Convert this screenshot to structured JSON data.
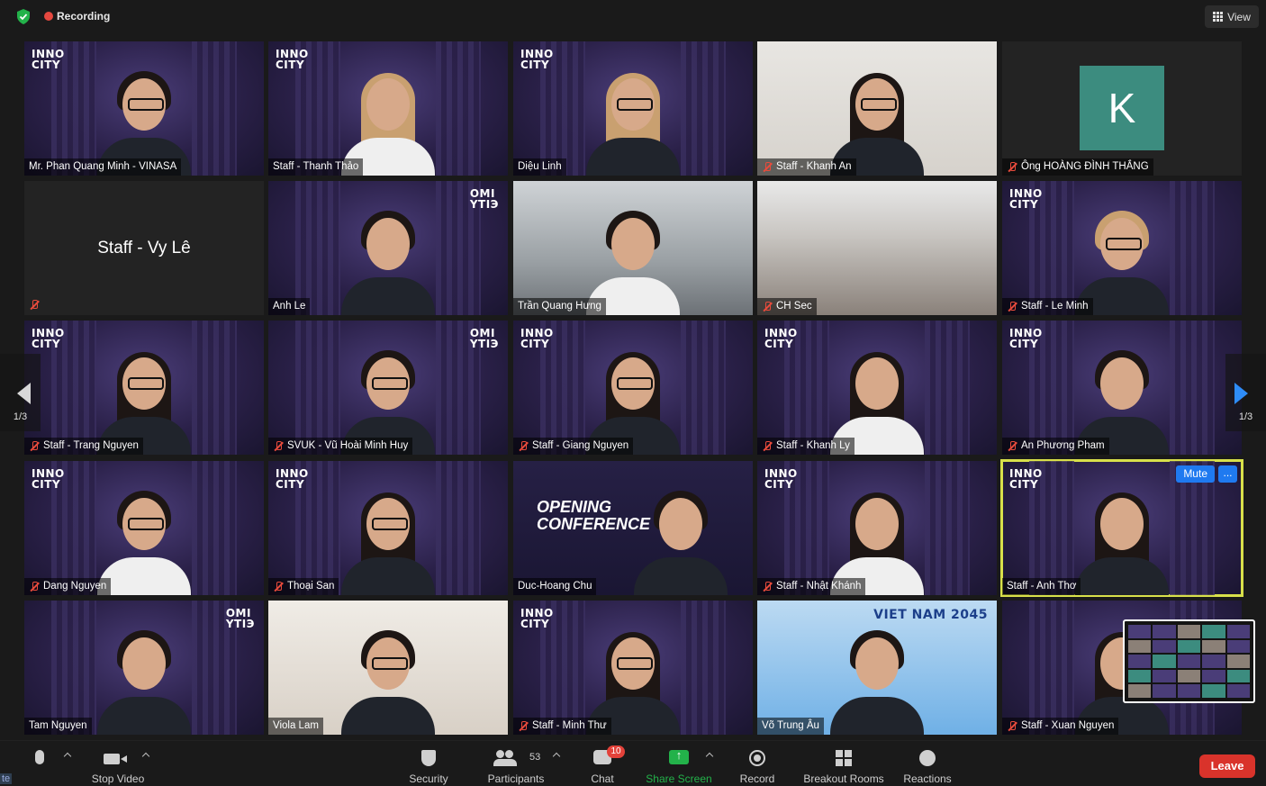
{
  "topbar": {
    "recording_label": "Recording",
    "view_label": "View"
  },
  "tiles": [
    {
      "name": "Mr. Phan Quang Minh - VINASA",
      "muted": false
    },
    {
      "name": "Staff - Thanh Thảo",
      "muted": false
    },
    {
      "name": "Diệu Linh",
      "muted": false
    },
    {
      "name": "Staff - Khanh An",
      "muted": true
    },
    {
      "name": "Ông  HOÀNG ĐÌNH THẮNG",
      "muted": true,
      "avatar_letter": "K"
    },
    {
      "name": "Staff - Vy Lê",
      "muted": true
    },
    {
      "name": "Anh Le",
      "muted": false
    },
    {
      "name": "Trần Quang Hưng",
      "muted": false
    },
    {
      "name": "CH Sec",
      "muted": true
    },
    {
      "name": "Staff - Le Minh",
      "muted": true
    },
    {
      "name": "Staff - Trang Nguyen",
      "muted": true
    },
    {
      "name": "SVUK - Vũ Hoài Minh Huy",
      "muted": true
    },
    {
      "name": "Staff - Giang Nguyen",
      "muted": true
    },
    {
      "name": "Staff - Khanh Ly",
      "muted": true
    },
    {
      "name": "An Phương Pham",
      "muted": true
    },
    {
      "name": "Dang Nguyen",
      "muted": true
    },
    {
      "name": "Thoại San",
      "muted": true
    },
    {
      "name": "Duc-Hoang Chu",
      "muted": false,
      "slide_title": "OPENING CONFERENCE"
    },
    {
      "name": "Staff - Nhật Khánh",
      "muted": true
    },
    {
      "name": "Staff - Anh Thơ",
      "muted": false,
      "mute_label": "Mute",
      "more_label": "..."
    },
    {
      "name": "Tam Nguyen",
      "muted": false
    },
    {
      "name": "Viola Lam",
      "muted": false
    },
    {
      "name": "Staff - Minh Thư",
      "muted": true
    },
    {
      "name": "Võ Trung Âu",
      "muted": false,
      "banner": "VIET NAM 2045"
    },
    {
      "name": "Staff - Xuan Nguyen",
      "muted": true
    }
  ],
  "logo_text": {
    "inno_line1": "INNO",
    "inno_line2": "CITY",
    "alt_line1": "OMI",
    "alt_line2": "YTIЭ"
  },
  "pagination": {
    "left_page": "1/3",
    "right_page": "1/3"
  },
  "toolbar": {
    "mute_stub": "te",
    "stop_video": "Stop Video",
    "security": "Security",
    "participants": "Participants",
    "participants_count": "53",
    "chat": "Chat",
    "chat_badge": "10",
    "share_screen": "Share Screen",
    "record": "Record",
    "breakout_rooms": "Breakout Rooms",
    "reactions": "Reactions",
    "leave": "Leave"
  },
  "colors": {
    "accent_blue": "#1f7af0",
    "share_green": "#23b24a",
    "leave_red": "#d9332b",
    "active_speaker": "#d8e04a",
    "recording_red": "#e5483f"
  }
}
